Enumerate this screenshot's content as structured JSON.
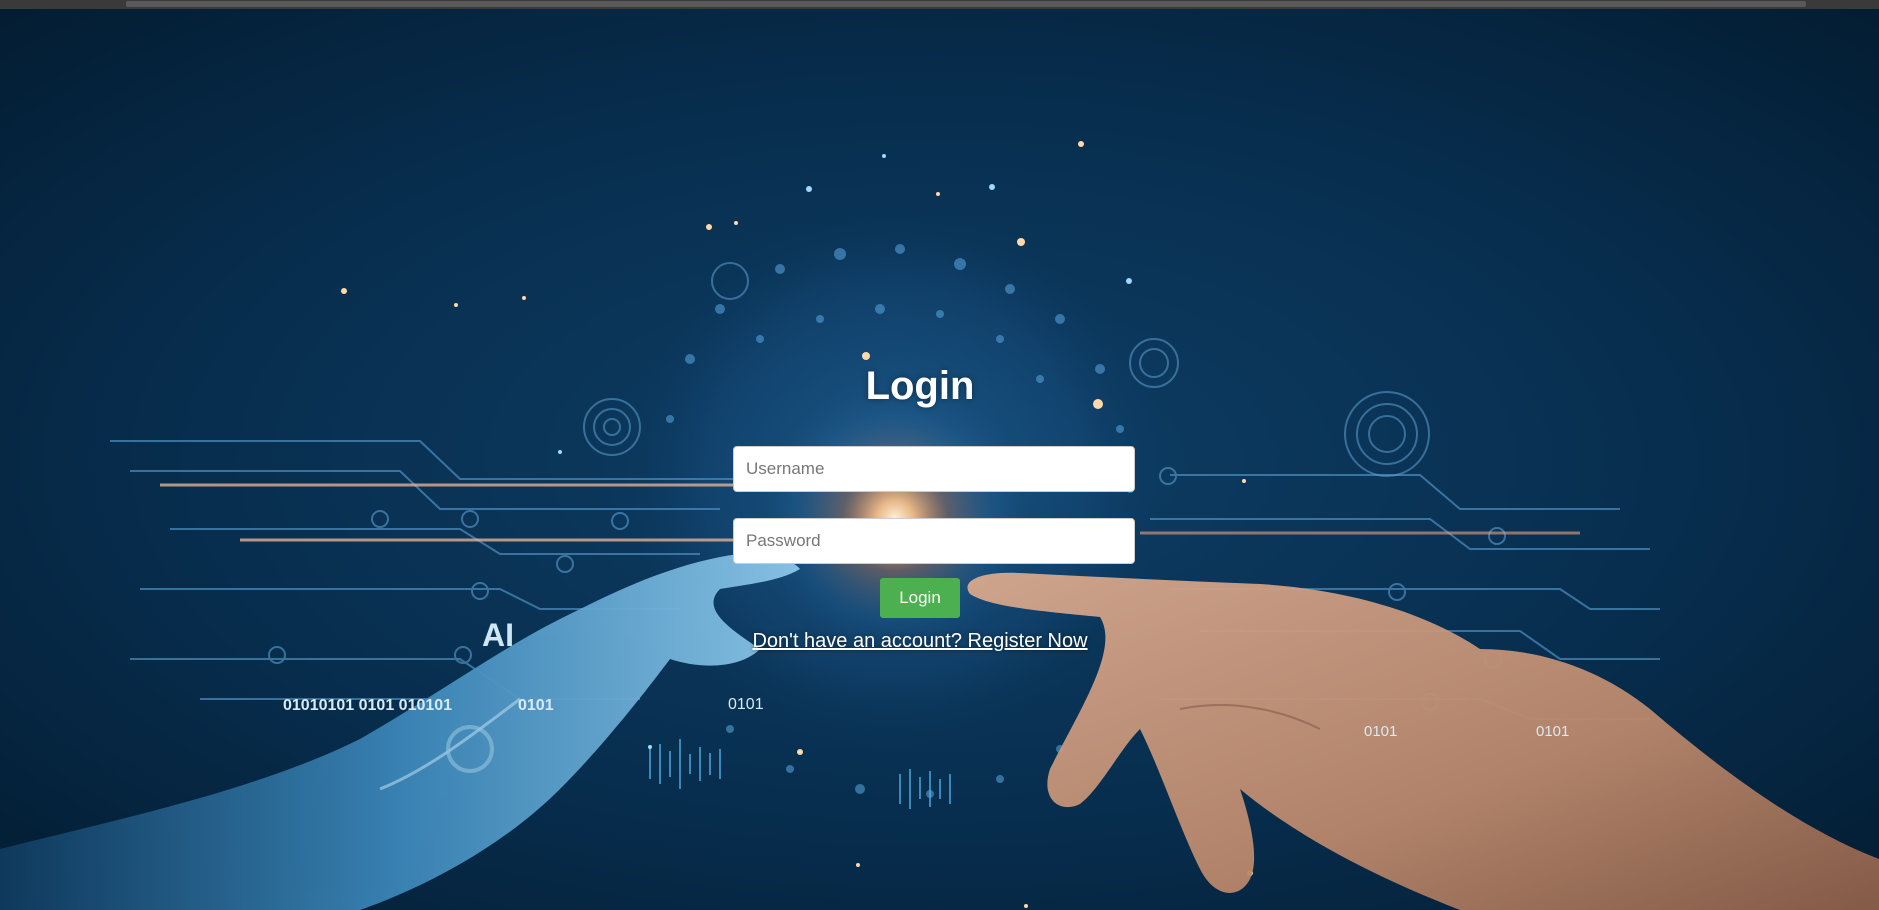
{
  "login": {
    "title": "Login",
    "username_placeholder": "Username",
    "password_placeholder": "Password",
    "button_label": "Login",
    "register_link": "Don't have an account? Register Now"
  },
  "background": {
    "ai_label": "AI",
    "binary_left": "01010101 0101 010101",
    "binary_mid": "0101",
    "binary_center": "0101",
    "binary_right_1": "0101",
    "binary_right_2": "0101"
  },
  "colors": {
    "background": "#062640",
    "button": "#4caf50",
    "text": "#ffffff"
  }
}
